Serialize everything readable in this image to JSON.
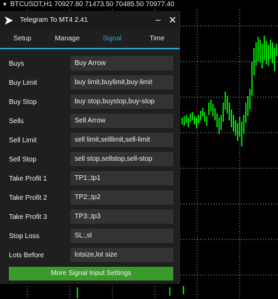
{
  "chart": {
    "symbol_line": "BTCUSDT,H1  70927.80 71473.50 70485.50 70977.40"
  },
  "window": {
    "title": "Telegram To MT4 2.41",
    "minimize_label": "–",
    "close_label": "✕"
  },
  "tabs": [
    {
      "label": "Setup"
    },
    {
      "label": "Manage"
    },
    {
      "label": "Signal",
      "active": true
    },
    {
      "label": "Time"
    }
  ],
  "fields": [
    {
      "label": "Buys",
      "value": "Buy Arrow"
    },
    {
      "label": "Buy Limit",
      "value": "buy limit,buylimit,buy-limit"
    },
    {
      "label": "Buy Stop",
      "value": "buy stop,buystop,buy-stop"
    },
    {
      "label": "Sells",
      "value": "Sell Arrow"
    },
    {
      "label": "Sell Limit",
      "value": "sell limit,selllimit,sell-limit"
    },
    {
      "label": "Sell Stop",
      "value": "sell stop,sellstop,sell-stop"
    },
    {
      "label": "Take Profit 1",
      "value": "TP1:,tp1"
    },
    {
      "label": "Take Profit 2",
      "value": "TP2:,tp2"
    },
    {
      "label": "Take Profit 3",
      "value": "TP3:,tp3"
    },
    {
      "label": "Stop Loss",
      "value": "SL:,sl"
    },
    {
      "label": "Lots Before",
      "value": "lotsize,lot size"
    }
  ],
  "more_button_label": "More Signal Input Settings",
  "colors": {
    "accent": "#2aa8d4",
    "candles": "#00d800",
    "button": "#3a9a2b"
  }
}
